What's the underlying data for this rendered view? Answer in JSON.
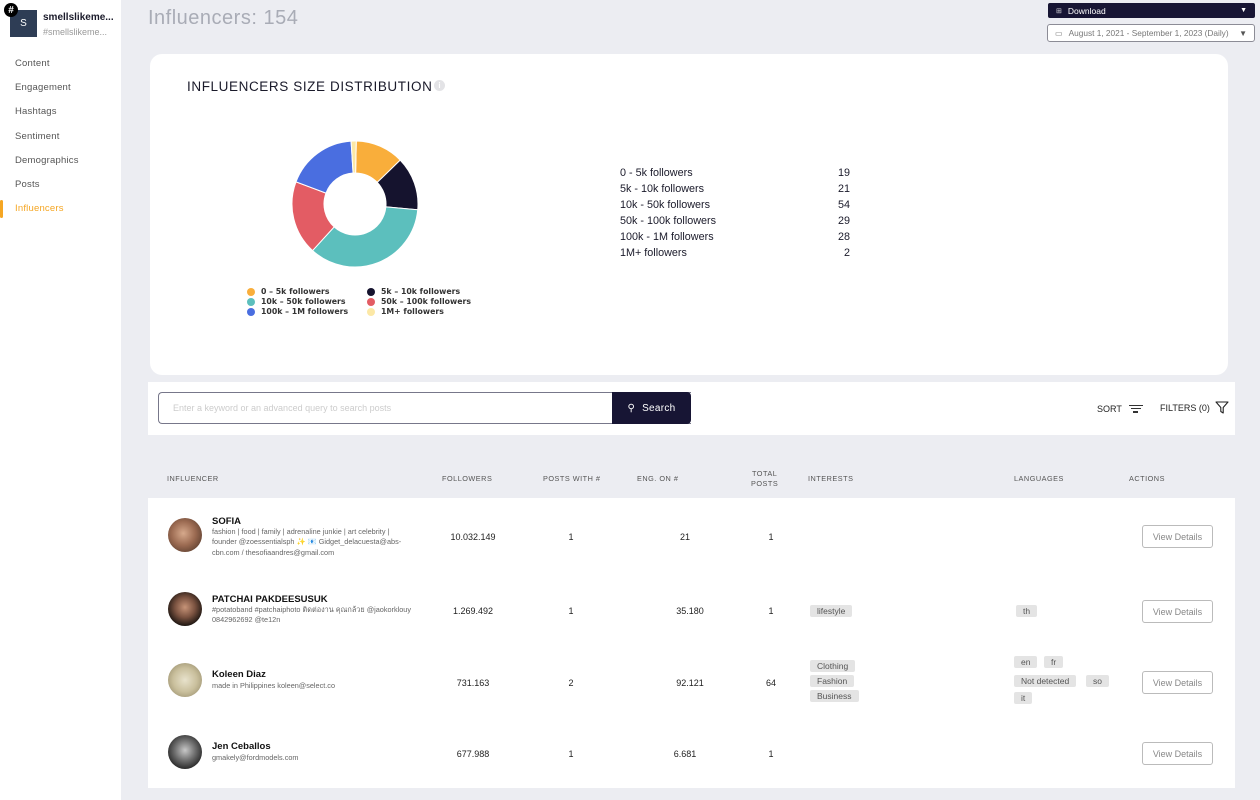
{
  "account": {
    "initial": "S",
    "badge": "#",
    "name": "smellslikeme...",
    "handle": "#smellslikeme..."
  },
  "sidebar": {
    "items": [
      {
        "label": "Content",
        "active": false
      },
      {
        "label": "Engagement",
        "active": false
      },
      {
        "label": "Hashtags",
        "active": false
      },
      {
        "label": "Sentiment",
        "active": false
      },
      {
        "label": "Demographics",
        "active": false
      },
      {
        "label": "Posts",
        "active": false
      },
      {
        "label": "Influencers",
        "active": true
      }
    ]
  },
  "header": {
    "title": "Influencers: 154",
    "download_label": "Download",
    "download_icon": "download-icon",
    "date_range": "August 1, 2021 - September 1, 2023 (Daily)",
    "date_icon": "calendar-icon"
  },
  "chart_card": {
    "title": "INFLUENCERS SIZE DISTRIBUTION",
    "info_icon": "i"
  },
  "chart_data": {
    "type": "pie",
    "title": "INFLUENCERS SIZE DISTRIBUTION",
    "donut": true,
    "categories": [
      "0 - 5k followers",
      "5k - 10k followers",
      "10k - 50k followers",
      "50k - 100k followers",
      "100k - 1M followers",
      "1M+ followers"
    ],
    "values": [
      19,
      21,
      54,
      29,
      28,
      2
    ],
    "colors": [
      "#f9ae3b",
      "#15132e",
      "#5cbfbd",
      "#e35c64",
      "#4a6ee0",
      "#fce8a6"
    ],
    "legend": {
      "placement": "bottom",
      "labels": [
        "0 – 5k followers",
        "5k – 10k followers",
        "10k – 50k followers",
        "50k – 100k followers",
        "100k – 1M followers",
        "1M+ followers"
      ]
    }
  },
  "distribution_table": [
    {
      "label": "0 - 5k followers",
      "count": "19"
    },
    {
      "label": "5k - 10k followers",
      "count": "21"
    },
    {
      "label": "10k - 50k followers",
      "count": "54"
    },
    {
      "label": "50k - 100k followers",
      "count": "29"
    },
    {
      "label": "100k - 1M followers",
      "count": "28"
    },
    {
      "label": "1M+ followers",
      "count": "2"
    }
  ],
  "search": {
    "placeholder": "Enter a keyword or an advanced query to search posts",
    "value": "",
    "button_label": "Search",
    "sort_label": "SORT",
    "filters_label": "FILTERS (0)"
  },
  "table": {
    "headers": {
      "influencer": "INFLUENCER",
      "followers": "FOLLOWERS",
      "posts_with": "POSTS WITH #",
      "eng_on": "ENG. ON #",
      "total_posts_1": "TOTAL",
      "total_posts_2": "POSTS",
      "interests": "INTERESTS",
      "languages": "LANGUAGES",
      "actions": "ACTIONS"
    },
    "rows": [
      {
        "name": "SOFIA",
        "bio": "fashion | food | family | adrenaline junkie | art celebrity | founder @zoessentialsph ✨ 📧 Gidget_delacuesta@abs-cbn.com / thesofiaandres@gmail.com",
        "followers": "10.032.149",
        "posts_with": "1",
        "eng_on": "21",
        "total_posts": "1",
        "interests": [],
        "languages": [],
        "action": "View Details"
      },
      {
        "name": "PATCHAI PAKDEESUSUK",
        "bio": "#potatoband #patchaiphoto ติดต่องาน คุณกล้วย @jaokorklouy 0842962692 @te12n",
        "followers": "1.269.492",
        "posts_with": "1",
        "eng_on": "35.180",
        "total_posts": "1",
        "interests": [
          "lifestyle"
        ],
        "languages": [
          "th"
        ],
        "action": "View Details"
      },
      {
        "name": "Koleen Diaz",
        "bio": "made in Philippines koleen@select.co",
        "followers": "731.163",
        "posts_with": "2",
        "eng_on": "92.121",
        "total_posts": "64",
        "interests": [
          "Clothing",
          "Fashion",
          "Business"
        ],
        "languages": [
          "en",
          "fr",
          "Not detected",
          "so",
          "it"
        ],
        "action": "View Details"
      },
      {
        "name": "Jen Ceballos",
        "bio": "gmakely@fordmodels.com",
        "followers": "677.988",
        "posts_with": "1",
        "eng_on": "6.681",
        "total_posts": "1",
        "interests": [],
        "languages": [],
        "action": "View Details"
      }
    ]
  }
}
